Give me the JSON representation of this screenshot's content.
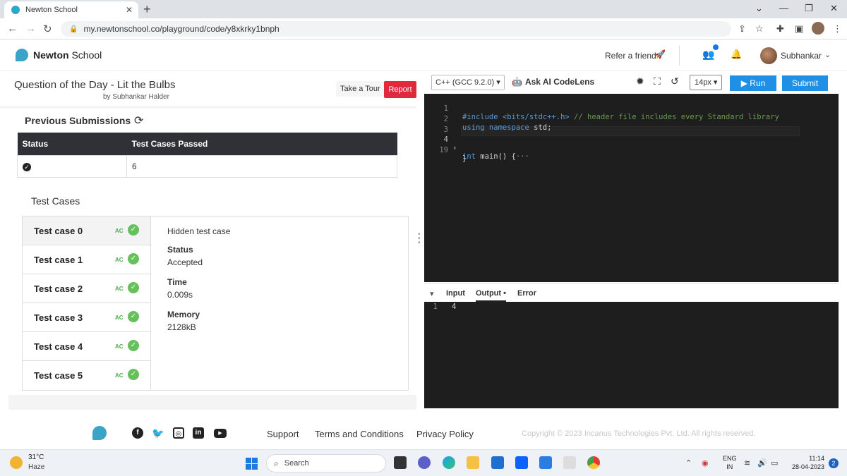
{
  "browser": {
    "tab_title": "Newton School",
    "url": "my.newtonschool.co/playground/code/y8xkrky1bnph",
    "new_tab_symbol": "+",
    "tab_close_symbol": "✕"
  },
  "site_header": {
    "brand_bold": "Newton",
    "brand_rest": " School",
    "refer_label": "Refer a friend",
    "username": "Subhankar"
  },
  "question": {
    "title": "Question of the Day - Lit the Bulbs",
    "author": "by Subhankar Halder",
    "tour_label": "Take a Tour",
    "report_label": "Report"
  },
  "submissions": {
    "heading": "Previous Submissions",
    "columns": [
      "Status",
      "Test Cases Passed"
    ],
    "rows": [
      {
        "status_icon": "check-circle-icon",
        "passed": "6"
      }
    ]
  },
  "test_cases": {
    "heading": "Test Cases",
    "badge": "AC",
    "items": [
      {
        "label": "Test case 0"
      },
      {
        "label": "Test case 1"
      },
      {
        "label": "Test case 2"
      },
      {
        "label": "Test case 3"
      },
      {
        "label": "Test case 4"
      },
      {
        "label": "Test case 5"
      }
    ],
    "detail": {
      "note": "Hidden test case",
      "status_label": "Status",
      "status_value": "Accepted",
      "time_label": "Time",
      "time_value": "0.009s",
      "memory_label": "Memory",
      "memory_value": "2128kB"
    }
  },
  "editor_toolbar": {
    "language": "C++ (GCC 9.2.0)",
    "codelens_label": "Ask AI CodeLens",
    "font_size": "14px",
    "run_label": "Run",
    "submit_label": "Submit"
  },
  "code": {
    "lines": [
      {
        "num": "1",
        "pre": "#include <bits/stdc++.h>",
        "comment": " // header file includes every Standard library"
      },
      {
        "num": "2",
        "kw": "using namespace",
        "rest": " std;"
      },
      {
        "num": "3",
        "rest": ""
      },
      {
        "num": "4",
        "kw": "int",
        "rest": " main() {",
        "fold": "›",
        "ellipsis": "···"
      },
      {
        "num": "19",
        "rest": "}"
      }
    ]
  },
  "output_panel": {
    "tabs": [
      "Input",
      "Output •",
      "Error"
    ],
    "active_tab": "Output •",
    "line_num": "1",
    "output_text": "4"
  },
  "footer": {
    "links": [
      "Support",
      "Terms and Conditions",
      "Privacy Policy"
    ],
    "copyright": "Copyright © 2023 Incanus Technologies Pvt. Ltd. All rights reserved."
  },
  "taskbar": {
    "temperature": "31°C",
    "condition": "Haze",
    "search_placeholder": "Search",
    "language_line1": "ENG",
    "language_line2": "IN",
    "time": "11:14",
    "date": "28-04-2023",
    "notification_count": "2"
  },
  "colors": {
    "accent_blue": "#1e90e6",
    "report_red": "#e0293d",
    "success_green": "#66c05b",
    "editor_bg": "#1e1e1e"
  }
}
